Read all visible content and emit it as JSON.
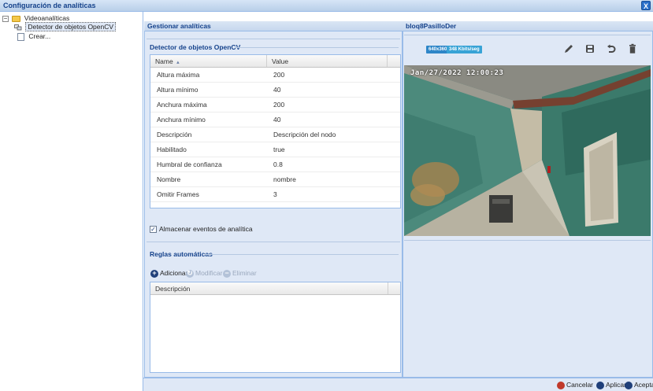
{
  "window": {
    "title": "Configuración de analíticas",
    "close_label": "X"
  },
  "tree": {
    "root": {
      "toggle": "−",
      "label": "Videoanalíticas"
    },
    "child": {
      "label": "Detector de objetos OpenCV"
    },
    "create": {
      "label": "Crear..."
    }
  },
  "manage": {
    "header": "Gestionar analíticas",
    "detector_section": "Detector de objetos OpenCV",
    "columns": {
      "name": "Name",
      "sort_indicator": "▴",
      "value": "Value"
    },
    "rows": [
      {
        "name": "Altura máxima",
        "value": "200"
      },
      {
        "name": "Altura mínimo",
        "value": "40"
      },
      {
        "name": "Anchura máxima",
        "value": "200"
      },
      {
        "name": "Anchura mínimo",
        "value": "40"
      },
      {
        "name": "Descripción",
        "value": "Descripción del nodo"
      },
      {
        "name": "Habilitado",
        "value": "true"
      },
      {
        "name": "Humbral de confianza",
        "value": "0.8"
      },
      {
        "name": "Nombre",
        "value": "nombre"
      },
      {
        "name": "Omitir Frames",
        "value": "3"
      }
    ],
    "store_events": {
      "checked": true,
      "check_glyph": "✓",
      "label": "Almacenar eventos de analítica"
    }
  },
  "rules": {
    "section": "Reglas automáticas",
    "add": "Adicionar",
    "modify": "Modificar",
    "delete": "Eliminar",
    "column": "Descripción"
  },
  "camera": {
    "header": "bloq8PasilloDer",
    "resolution_badge": "640x360",
    "bitrate_badge": "348 Kbits/seg",
    "timestamp": "Jan/27/2022 12:00:23",
    "icons": [
      "pencil-icon",
      "save-icon",
      "undo-icon",
      "trash-icon"
    ]
  },
  "footer": {
    "cancel": "Cancelar",
    "apply": "Aplicar",
    "accept": "Aceptar"
  },
  "colors": {
    "accent": "#15428b",
    "panel": "#dfe8f6",
    "border": "#99bbe8",
    "badge": "#2e86c8",
    "badge2": "#38a3d6"
  }
}
